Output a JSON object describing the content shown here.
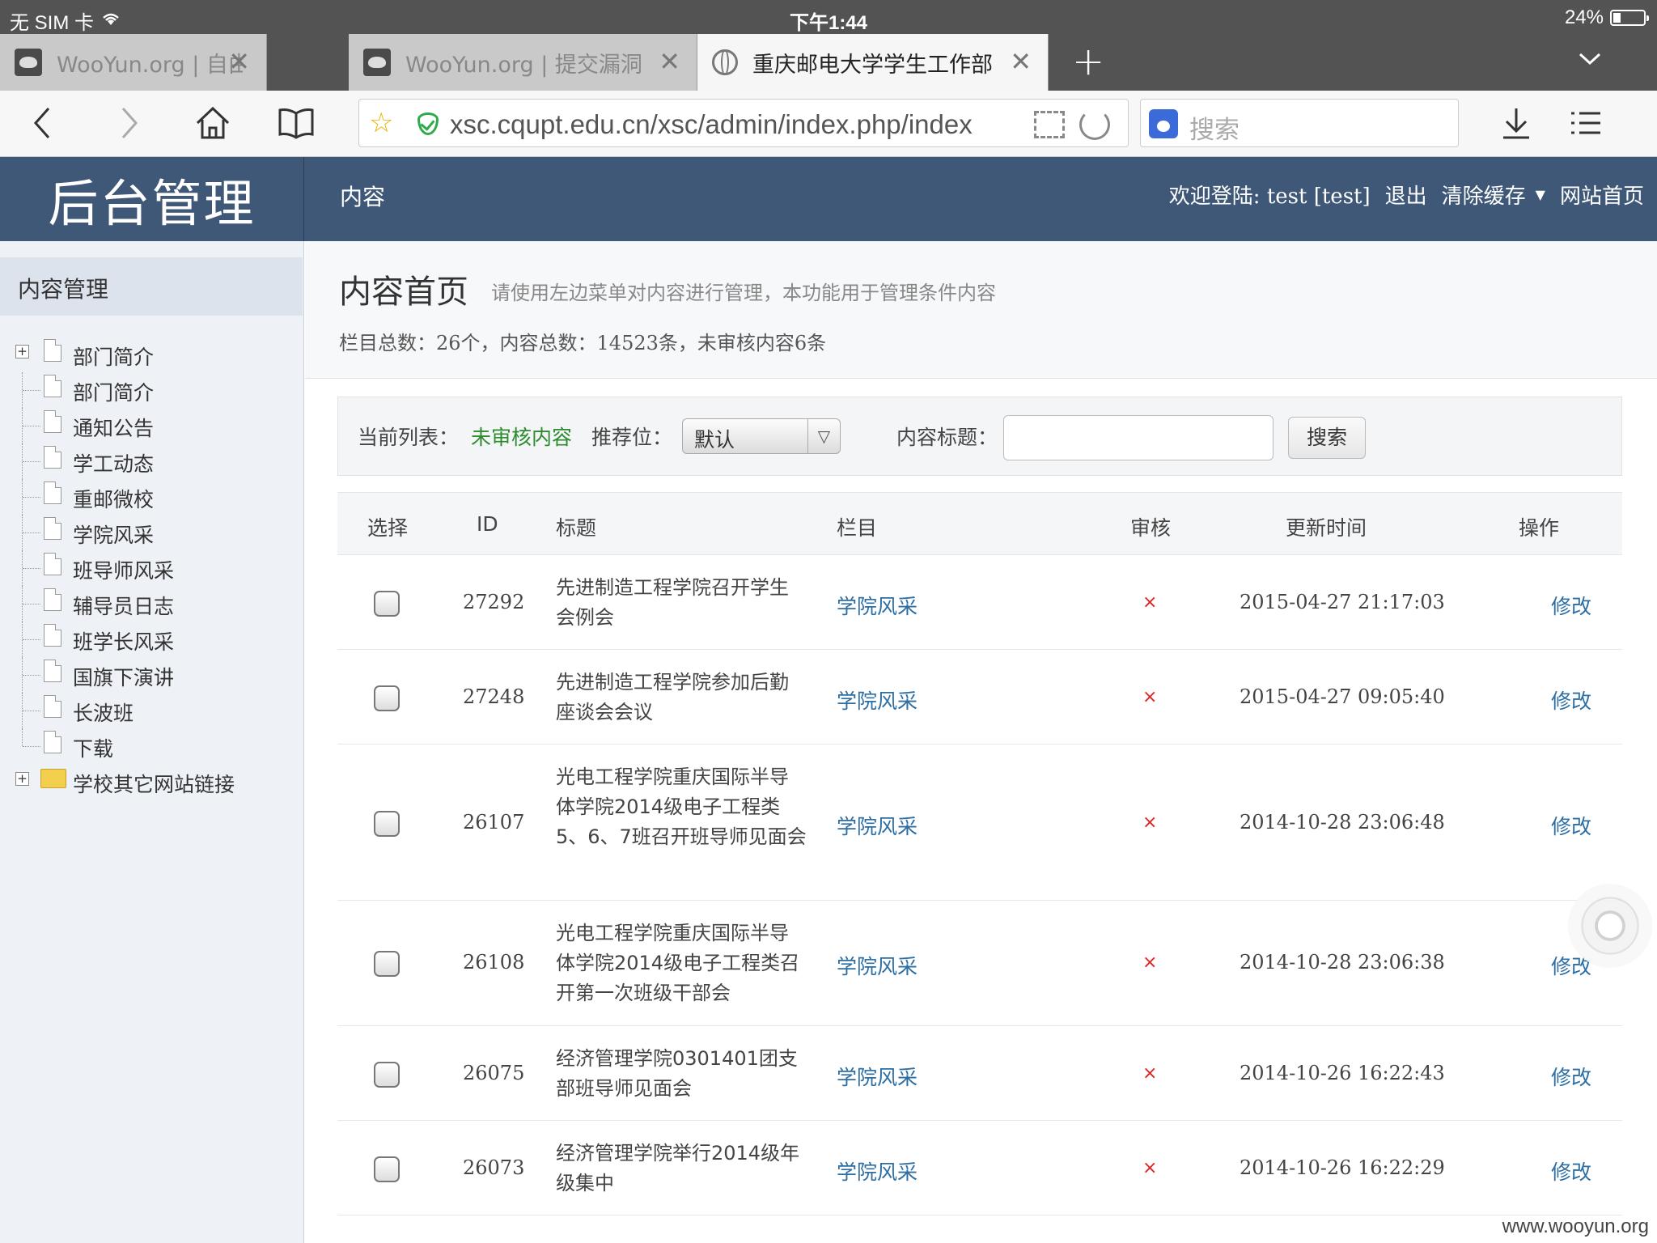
{
  "status": {
    "carrier": "无 SIM 卡",
    "time": "下午1:44",
    "battery": "24%",
    "battery_level": 0.24
  },
  "tabs": [
    {
      "title": "WooYun.org | 自由平等",
      "active": false
    },
    {
      "title": "WooYun.org | 提交漏洞",
      "active": false
    },
    {
      "title": "重庆邮电大学学生工作部",
      "active": true
    }
  ],
  "address": {
    "url": "xsc.cqupt.edu.cn/xsc/admin/index.php/index",
    "search_placeholder": "搜索"
  },
  "app": {
    "logo": "后台管理",
    "nav": "内容",
    "welcome": "欢迎登陆: test [test]",
    "logout": "退出",
    "clear_cache": "清除缓存",
    "home": "网站首页"
  },
  "sidebar": {
    "title": "内容管理",
    "items": [
      {
        "label": "部门简介",
        "type": "doc",
        "expand": true
      },
      {
        "label": "部门简介",
        "type": "doc"
      },
      {
        "label": "通知公告",
        "type": "doc"
      },
      {
        "label": "学工动态",
        "type": "doc"
      },
      {
        "label": "重邮微校",
        "type": "doc"
      },
      {
        "label": "学院风采",
        "type": "doc"
      },
      {
        "label": "班导师风采",
        "type": "doc"
      },
      {
        "label": "辅导员日志",
        "type": "doc"
      },
      {
        "label": "班学长风采",
        "type": "doc"
      },
      {
        "label": "国旗下演讲",
        "type": "doc"
      },
      {
        "label": "长波班",
        "type": "doc"
      },
      {
        "label": "下载",
        "type": "doc"
      },
      {
        "label": "学校其它网站链接",
        "type": "folder",
        "expand": true
      }
    ]
  },
  "page": {
    "title": "内容首页",
    "desc": "请使用左边菜单对内容进行管理，本功能用于管理条件内容",
    "stats": "栏目总数：26个，内容总数：14523条，未审核内容6条"
  },
  "filter": {
    "list_label": "当前列表：",
    "list_value": "未审核内容",
    "pos_label": "推荐位：",
    "pos_value": "默认",
    "title_label": "内容标题：",
    "title_value": "",
    "search_button": "搜索"
  },
  "table": {
    "headers": [
      "选择",
      "ID",
      "标题",
      "栏目",
      "审核",
      "更新时间",
      "操作"
    ],
    "rows": [
      {
        "id": "27292",
        "title": "先进制造工程学院召开学生会例会",
        "column": "学院风采",
        "audit": "×",
        "time": "2015-04-27 21:17:03",
        "op": "修改"
      },
      {
        "id": "27248",
        "title": "先进制造工程学院参加后勤座谈会会议",
        "column": "学院风采",
        "audit": "×",
        "time": "2015-04-27 09:05:40",
        "op": "修改"
      },
      {
        "id": "26107",
        "title": "光电工程学院重庆国际半导体学院2014级电子工程类5、6、7班召开班导师见面会",
        "column": "学院风采",
        "audit": "×",
        "time": "2014-10-28 23:06:48",
        "op": "修改"
      },
      {
        "id": "26108",
        "title": "光电工程学院重庆国际半导体学院2014级电子工程类召开第一次班级干部会",
        "column": "学院风采",
        "audit": "×",
        "time": "2014-10-28 23:06:38",
        "op": "修改"
      },
      {
        "id": "26075",
        "title": "经济管理学院0301401团支部班导师见面会",
        "column": "学院风采",
        "audit": "×",
        "time": "2014-10-26 16:22:43",
        "op": "修改"
      },
      {
        "id": "26073",
        "title": "经济管理学院举行2014级年级集中",
        "column": "学院风采",
        "audit": "×",
        "time": "2014-10-26 16:22:29",
        "op": "修改"
      }
    ]
  },
  "watermark": "www.wooyun.org"
}
